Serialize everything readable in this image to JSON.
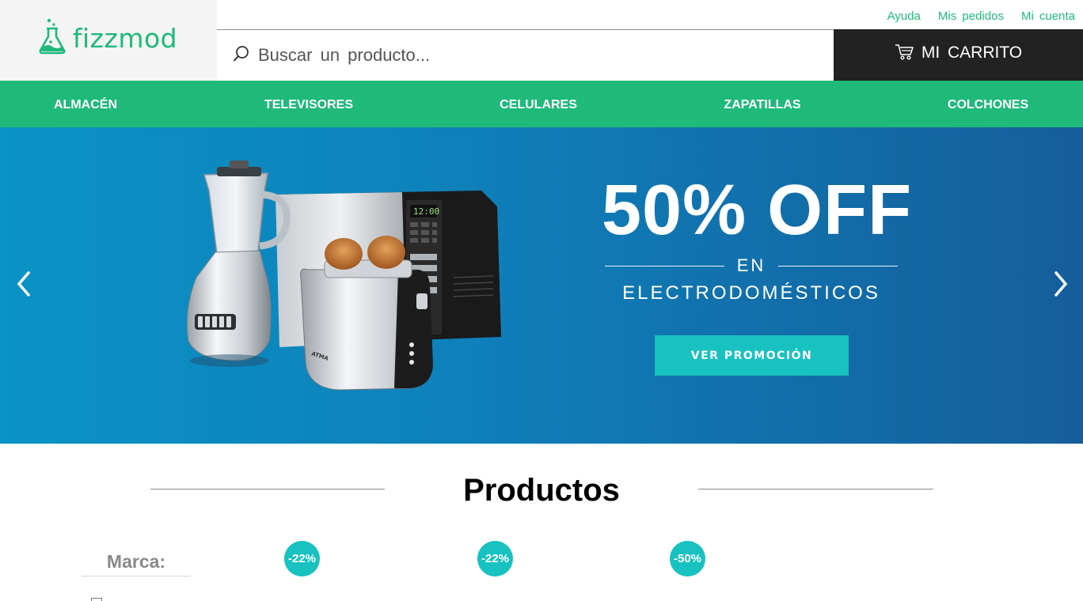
{
  "brand": {
    "name": "fizzmod",
    "color": "#1fb97a"
  },
  "top_links": [
    "Ayuda",
    "Mis pedidos",
    "Mi cuenta"
  ],
  "search": {
    "placeholder": "Buscar un producto..."
  },
  "cart": {
    "label": "MI CARRITO"
  },
  "nav": {
    "items": [
      "ALMACÉN",
      "TELEVISORES",
      "CELULARES",
      "ZAPATILLAS",
      "COLCHONES"
    ]
  },
  "hero": {
    "headline": "50% OFF",
    "connector": "EN",
    "subtitle": "ELECTRODOMÉSTICOS",
    "button": "VER PROMOCIÓN",
    "gradient": [
      "#0a93c6",
      "#155e9b"
    ]
  },
  "products": {
    "title": "Productos",
    "filter_title": "Marca:",
    "badges": [
      "-22%",
      "-22%",
      "-50%"
    ]
  },
  "colors": {
    "accent": "#1fb97a",
    "teal": "#17c2c0",
    "dark": "#222222"
  },
  "icons": [
    "flask-icon",
    "search-icon",
    "cart-icon",
    "chevron-left-icon",
    "chevron-right-icon"
  ]
}
